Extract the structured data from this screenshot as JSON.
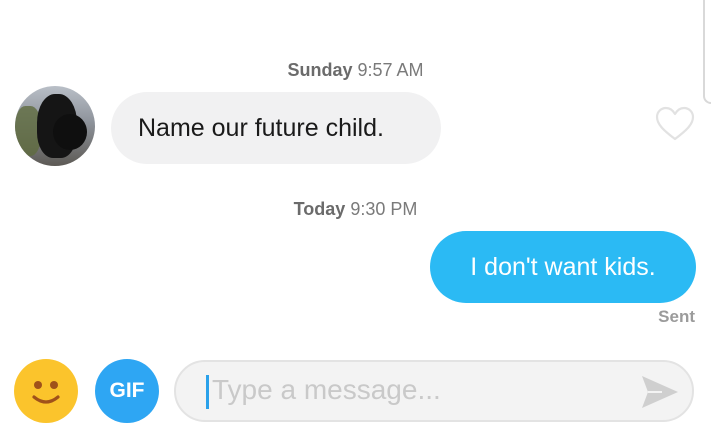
{
  "thread": {
    "timestamp_1": {
      "day": "Sunday",
      "time": "9:57 AM"
    },
    "incoming_message": "Name our future child.",
    "timestamp_2": {
      "day": "Today",
      "time": "9:30 PM"
    },
    "outgoing_message": "I don't want kids.",
    "outgoing_status": "Sent"
  },
  "composer": {
    "gif_label": "GIF",
    "placeholder": "Type a message..."
  },
  "colors": {
    "outgoing_bubble": "#2bbaf4",
    "incoming_bubble": "#f1f1f2",
    "emoji_button": "#fbc42c",
    "gif_button": "#2ea6f3"
  },
  "icons": {
    "like": "heart-icon",
    "emoji": "smiley-face-icon",
    "send": "send-arrow-icon"
  }
}
